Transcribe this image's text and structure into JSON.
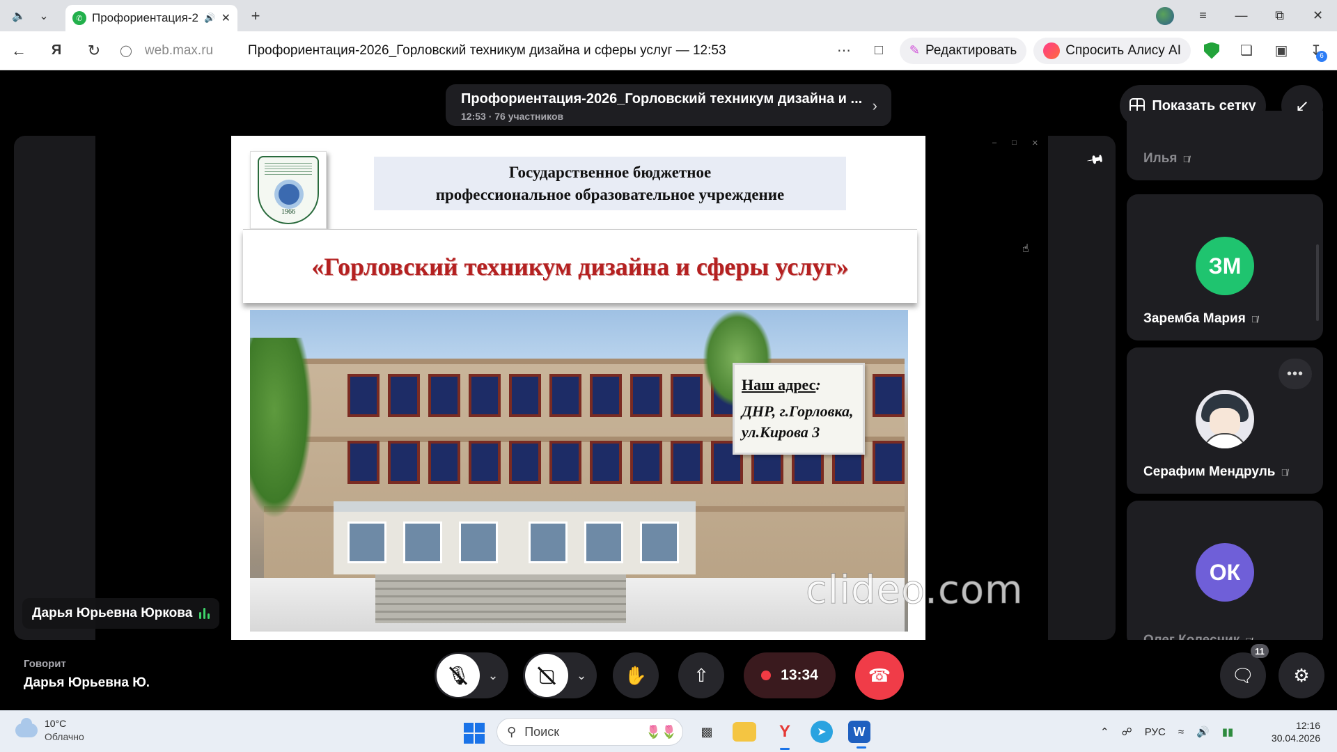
{
  "browser": {
    "tab_title": "Профориентация-2026_Горловский техникум дизайна и сферы услуг",
    "url_domain": "web.max.ru",
    "page_title": "Профориентация-2026_Горловский техникум дизайна и сферы услуг — 12:53",
    "edit_label": "Редактировать",
    "alice_label": "Спросить Алису AI",
    "downloads_badge": "6"
  },
  "call": {
    "title": "Профориентация-2026_Горловский техникум дизайна и ...",
    "subtitle": "12:53 · 76 участников",
    "grid_button": "Показать сетку",
    "speaker_tag": "Дарья Юрьевна Юркова",
    "speaking_label": "Говорит",
    "speaking_name": "Дарья Юрьевна Ю.",
    "record_time": "13:34",
    "chat_badge": "11"
  },
  "slide": {
    "header_line1": "Государственное бюджетное",
    "header_line2": "профессиональное образовательное учреждение",
    "org_name": "«Горловский техникум дизайна и сферы услуг»",
    "logo_year": "1966",
    "address_heading": "Наш адрес",
    "address_line1": "ДНР, г.Горловка,",
    "address_line2": "ул.Кирова 3",
    "watermark": "clideo.com"
  },
  "participants": [
    {
      "name": "Илья",
      "initials": "",
      "color": "",
      "muted": true
    },
    {
      "name": "Заремба Мария",
      "initials": "ЗМ",
      "color": "#1fc46f",
      "muted": true
    },
    {
      "name": "Серафим Мендруль",
      "initials": "",
      "color": "",
      "muted": true
    },
    {
      "name": "Олег Колесник",
      "initials": "ОК",
      "color": "#6f5fd8",
      "muted": true
    }
  ],
  "taskbar": {
    "temperature": "10°C",
    "weather": "Облачно",
    "search_placeholder": "Поиск",
    "language": "РУС",
    "time": "12:16",
    "date": "30.04.2026"
  },
  "colors": {
    "accent_red": "#f03c48",
    "recording_bg": "#3a1a1e",
    "panel_bg": "#1e1e22",
    "slide_title_red": "#b42020"
  }
}
